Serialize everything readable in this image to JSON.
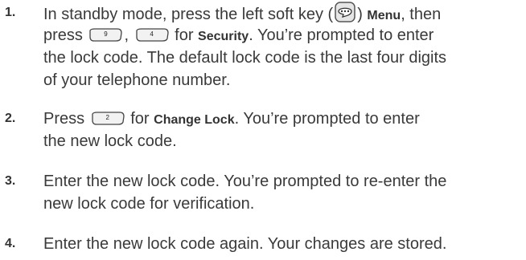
{
  "steps": [
    {
      "num": "1.",
      "l1a": "In standby mode, press the left soft key (",
      "l1b": ") ",
      "l1menu": "Menu",
      "l1c": ", then",
      "l2a": "press ",
      "key9": "9",
      "l2b": ", ",
      "key4": "4",
      "l2c": " for ",
      "l2security": "Security",
      "l2d": ". You’re prompted to enter",
      "l3": "the lock code. The default lock code is the last four digits",
      "l4": "of your telephone number."
    },
    {
      "num": "2.",
      "l1a": "Press ",
      "key2": "2",
      "l1b": " for ",
      "l1bold": "Change Lock",
      "l1c": ". You’re prompted to enter",
      "l2": "the new lock code."
    },
    {
      "num": "3.",
      "l1": "Enter the new lock code. You’re prompted to re-enter the",
      "l2": "new lock code for verification."
    },
    {
      "num": "4.",
      "l1": "Enter the new lock code again. Your changes are stored."
    }
  ],
  "icons": {
    "softkey": "left-soft-key-icon",
    "key": "phone-number-key-icon"
  }
}
